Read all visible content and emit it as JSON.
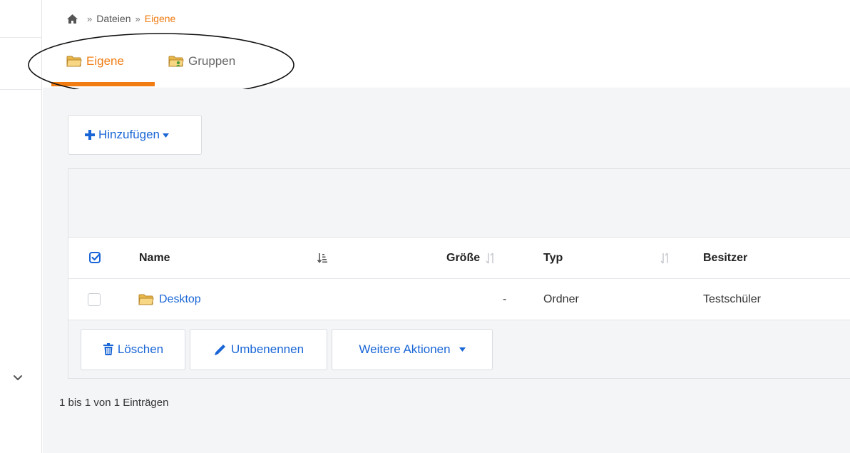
{
  "breadcrumb": {
    "items": [
      "Dateien",
      "Eigene"
    ],
    "separator": "»"
  },
  "tabs": [
    {
      "label": "Eigene",
      "active": true
    },
    {
      "label": "Gruppen",
      "active": false
    }
  ],
  "toolbar": {
    "add_label": "Hinzufügen"
  },
  "table": {
    "columns": [
      "Name",
      "Größe",
      "Typ",
      "Besitzer"
    ],
    "rows": [
      {
        "name": "Desktop",
        "size": "-",
        "type": "Ordner",
        "owner": "Testschüler"
      }
    ]
  },
  "actions": {
    "delete_label": "Löschen",
    "rename_label": "Umbenennen",
    "more_label": "Weitere Aktionen"
  },
  "footer": {
    "info": "1 bis 1 von 1 Einträgen"
  },
  "colors": {
    "accent": "#f07c12",
    "link": "#1a66d6",
    "background": "#f4f5f7"
  },
  "icons": [
    "home-icon",
    "folder-icon",
    "group-folder-icon",
    "plus-icon",
    "caret-down-icon",
    "checkbox-all-icon",
    "sort-icon",
    "trash-icon",
    "pencil-icon",
    "chevron-down-icon"
  ]
}
